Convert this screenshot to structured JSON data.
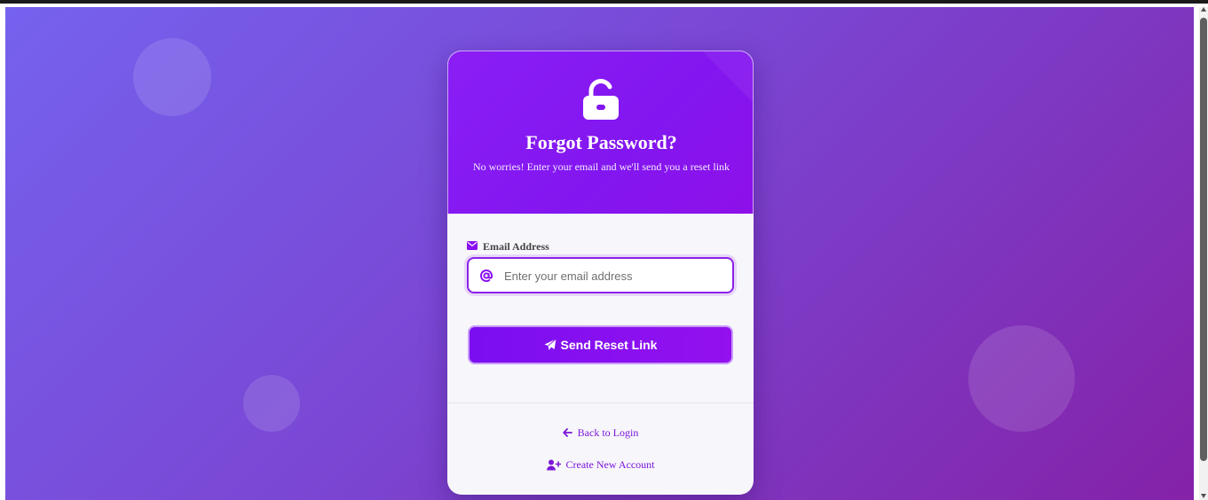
{
  "page": {
    "background_colors": [
      "#7562ee",
      "#8422a8"
    ],
    "accent_color": "#8a10f0"
  },
  "header": {
    "icon": "unlock-icon",
    "title": "Forgot Password?",
    "subtitle": "No worries! Enter your email and we'll send you a reset link"
  },
  "form": {
    "email_label": "Email Address",
    "email_label_icon": "envelope-icon",
    "email_field_icon": "at-sign-icon",
    "email_value": "",
    "email_placeholder": "Enter your email address",
    "submit_label": "Send Reset Link",
    "submit_icon": "paper-plane-icon"
  },
  "footer": {
    "back_label": "Back to Login",
    "back_icon": "arrow-left-icon",
    "create_label": "Create New Account",
    "create_icon": "user-plus-icon"
  }
}
